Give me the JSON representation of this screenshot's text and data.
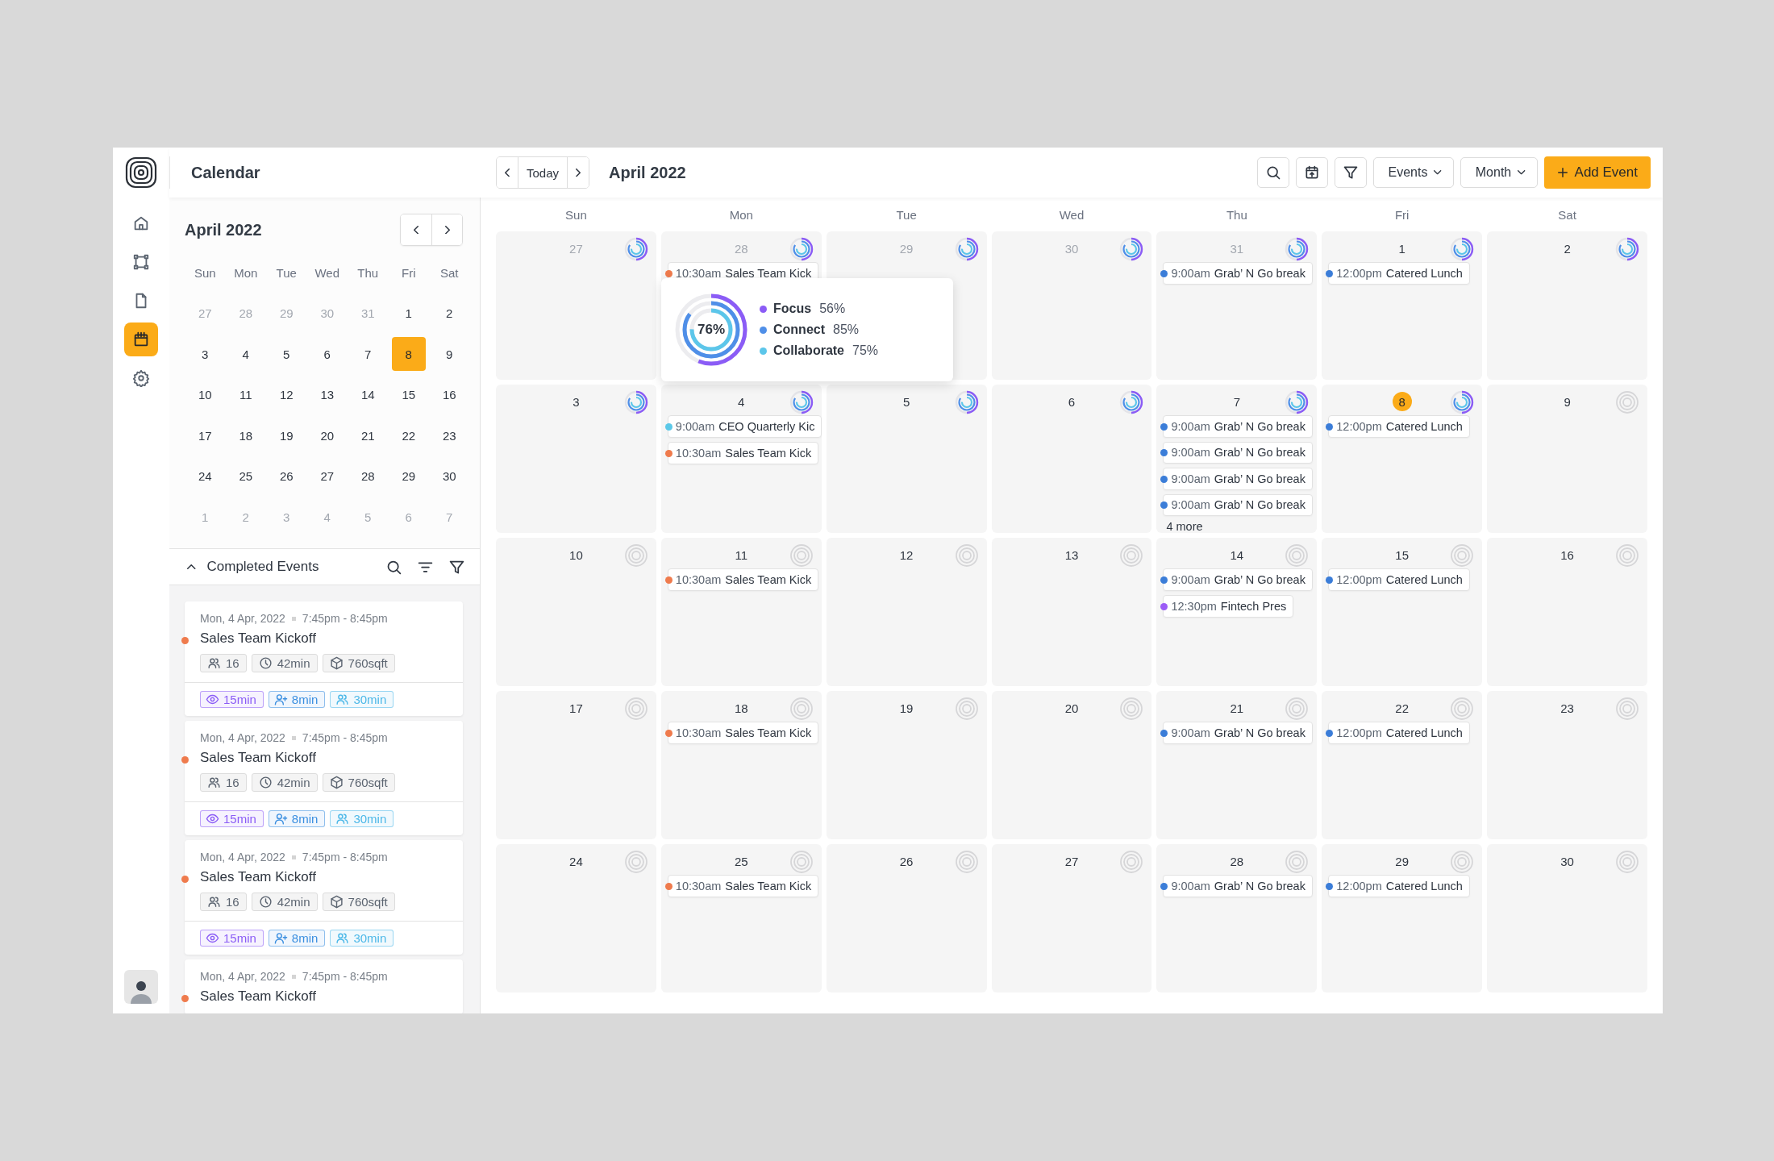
{
  "app": {
    "title": "Calendar"
  },
  "rail": {
    "items": [
      {
        "selected": false
      },
      {
        "selected": false
      },
      {
        "selected": false
      },
      {
        "selected": true
      },
      {
        "selected": false
      }
    ]
  },
  "mini_calendar": {
    "title": "April 2022",
    "weekdays": [
      "Sun",
      "Mon",
      "Tue",
      "Wed",
      "Thu",
      "Fri",
      "Sat"
    ],
    "weeks": [
      [
        {
          "day": "27",
          "muted": true,
          "selected": false
        },
        {
          "day": "28",
          "muted": true,
          "selected": false
        },
        {
          "day": "29",
          "muted": true,
          "selected": false
        },
        {
          "day": "30",
          "muted": true,
          "selected": false
        },
        {
          "day": "31",
          "muted": true,
          "selected": false
        },
        {
          "day": "1",
          "muted": false,
          "selected": false
        },
        {
          "day": "2",
          "muted": false,
          "selected": false
        }
      ],
      [
        {
          "day": "3",
          "muted": false,
          "selected": false
        },
        {
          "day": "4",
          "muted": false,
          "selected": false
        },
        {
          "day": "5",
          "muted": false,
          "selected": false
        },
        {
          "day": "6",
          "muted": false,
          "selected": false
        },
        {
          "day": "7",
          "muted": false,
          "selected": false
        },
        {
          "day": "8",
          "muted": false,
          "selected": true
        },
        {
          "day": "9",
          "muted": false,
          "selected": false
        }
      ],
      [
        {
          "day": "10",
          "muted": false,
          "selected": false
        },
        {
          "day": "11",
          "muted": false,
          "selected": false
        },
        {
          "day": "12",
          "muted": false,
          "selected": false
        },
        {
          "day": "13",
          "muted": false,
          "selected": false
        },
        {
          "day": "14",
          "muted": false,
          "selected": false
        },
        {
          "day": "15",
          "muted": false,
          "selected": false
        },
        {
          "day": "16",
          "muted": false,
          "selected": false
        }
      ],
      [
        {
          "day": "17",
          "muted": false,
          "selected": false
        },
        {
          "day": "18",
          "muted": false,
          "selected": false
        },
        {
          "day": "19",
          "muted": false,
          "selected": false
        },
        {
          "day": "20",
          "muted": false,
          "selected": false
        },
        {
          "day": "21",
          "muted": false,
          "selected": false
        },
        {
          "day": "22",
          "muted": false,
          "selected": false
        },
        {
          "day": "23",
          "muted": false,
          "selected": false
        }
      ],
      [
        {
          "day": "24",
          "muted": false,
          "selected": false
        },
        {
          "day": "25",
          "muted": false,
          "selected": false
        },
        {
          "day": "26",
          "muted": false,
          "selected": false
        },
        {
          "day": "27",
          "muted": false,
          "selected": false
        },
        {
          "day": "28",
          "muted": false,
          "selected": false
        },
        {
          "day": "29",
          "muted": false,
          "selected": false
        },
        {
          "day": "30",
          "muted": false,
          "selected": false
        }
      ],
      [
        {
          "day": "1",
          "muted": true,
          "selected": false
        },
        {
          "day": "2",
          "muted": true,
          "selected": false
        },
        {
          "day": "3",
          "muted": true,
          "selected": false
        },
        {
          "day": "4",
          "muted": true,
          "selected": false
        },
        {
          "day": "5",
          "muted": true,
          "selected": false
        },
        {
          "day": "6",
          "muted": true,
          "selected": false
        },
        {
          "day": "7",
          "muted": true,
          "selected": false
        }
      ]
    ]
  },
  "completed_events": {
    "title": "Completed Events",
    "expanded": true,
    "cards": [
      {
        "date": "Mon, 4 Apr, 2022",
        "time": "7:45pm - 8:45pm",
        "title": "Sales Team Kickoff",
        "color": "#ef7b4d",
        "stats": [
          "16",
          "42min",
          "760sqft"
        ],
        "tags": [
          {
            "text": "15min",
            "color": "#8b5cf6"
          },
          {
            "text": "8min",
            "color": "#3b8fe0"
          },
          {
            "text": "30min",
            "color": "#4cb8e8"
          }
        ]
      },
      {
        "date": "Mon, 4 Apr, 2022",
        "time": "7:45pm - 8:45pm",
        "title": "Sales Team Kickoff",
        "color": "#ef7b4d",
        "stats": [
          "16",
          "42min",
          "760sqft"
        ],
        "tags": [
          {
            "text": "15min",
            "color": "#8b5cf6"
          },
          {
            "text": "8min",
            "color": "#3b8fe0"
          },
          {
            "text": "30min",
            "color": "#4cb8e8"
          }
        ]
      },
      {
        "date": "Mon, 4 Apr, 2022",
        "time": "7:45pm - 8:45pm",
        "title": "Sales Team Kickoff",
        "color": "#ef7b4d",
        "stats": [
          "16",
          "42min",
          "760sqft"
        ],
        "tags": [
          {
            "text": "15min",
            "color": "#8b5cf6"
          },
          {
            "text": "8min",
            "color": "#3b8fe0"
          },
          {
            "text": "30min",
            "color": "#4cb8e8"
          }
        ]
      },
      {
        "date": "Mon, 4 Apr, 2022",
        "time": "7:45pm - 8:45pm",
        "title": "Sales Team Kickoff",
        "color": "#ef7b4d"
      }
    ]
  },
  "toolbar": {
    "today": "Today",
    "title": "April 2022",
    "events_dropdown": "Events",
    "view_dropdown": "Month",
    "add_button": "Add Event"
  },
  "month": {
    "weekdays": [
      "Sun",
      "Mon",
      "Tue",
      "Wed",
      "Thu",
      "Fri",
      "Sat"
    ],
    "weeks": [
      [
        {
          "day": "27",
          "muted": true,
          "today": false,
          "scored": true
        },
        {
          "day": "28",
          "muted": true,
          "today": false,
          "scored": true,
          "events": [
            {
              "time": "10:30am",
              "title": "Sales Team Kick",
              "color": "#ef7b4d"
            }
          ]
        },
        {
          "day": "29",
          "muted": true,
          "today": false,
          "scored": true
        },
        {
          "day": "30",
          "muted": true,
          "today": false,
          "scored": true
        },
        {
          "day": "31",
          "muted": true,
          "today": false,
          "scored": true,
          "events": [
            {
              "time": "9:00am",
              "title": "Grab’ N Go break",
              "color": "#3b7dd8"
            }
          ]
        },
        {
          "day": "1",
          "muted": false,
          "today": false,
          "scored": true,
          "events": [
            {
              "time": "12:00pm",
              "title": "Catered Lunch",
              "color": "#3b7dd8"
            }
          ]
        },
        {
          "day": "2",
          "muted": false,
          "today": false,
          "scored": true
        }
      ],
      [
        {
          "day": "3",
          "muted": false,
          "today": false,
          "scored": true
        },
        {
          "day": "4",
          "muted": false,
          "today": false,
          "scored": true,
          "events": [
            {
              "time": "9:00am",
              "title": "CEO Quarterly Kic",
              "color": "#5bc8e8"
            },
            {
              "time": "10:30am",
              "title": "Sales Team Kick",
              "color": "#ef7b4d"
            }
          ]
        },
        {
          "day": "5",
          "muted": false,
          "today": false,
          "scored": true
        },
        {
          "day": "6",
          "muted": false,
          "today": false,
          "scored": true
        },
        {
          "day": "7",
          "muted": false,
          "today": false,
          "scored": true,
          "events": [
            {
              "time": "9:00am",
              "title": "Grab’ N Go break",
              "color": "#3b7dd8"
            },
            {
              "time": "9:00am",
              "title": "Grab’ N Go break",
              "color": "#3b7dd8"
            },
            {
              "time": "9:00am",
              "title": "Grab’ N Go break",
              "color": "#3b7dd8"
            },
            {
              "time": "9:00am",
              "title": "Grab’ N Go break",
              "color": "#3b7dd8"
            }
          ],
          "more": "4 more"
        },
        {
          "day": "8",
          "muted": false,
          "today": true,
          "scored": true,
          "events": [
            {
              "time": "12:00pm",
              "title": "Catered Lunch",
              "color": "#3b7dd8"
            }
          ]
        },
        {
          "day": "9",
          "muted": false,
          "today": false,
          "scored": false
        }
      ],
      [
        {
          "day": "10",
          "muted": false,
          "today": false,
          "scored": false
        },
        {
          "day": "11",
          "muted": false,
          "today": false,
          "scored": false,
          "events": [
            {
              "time": "10:30am",
              "title": "Sales Team Kick",
              "color": "#ef7b4d"
            }
          ]
        },
        {
          "day": "12",
          "muted": false,
          "today": false,
          "scored": false
        },
        {
          "day": "13",
          "muted": false,
          "today": false,
          "scored": false
        },
        {
          "day": "14",
          "muted": false,
          "today": false,
          "scored": false,
          "events": [
            {
              "time": "9:00am",
              "title": "Grab’ N Go break",
              "color": "#3b7dd8"
            },
            {
              "time": "12:30pm",
              "title": "Fintech Pres",
              "color": "#9b5cf6"
            }
          ]
        },
        {
          "day": "15",
          "muted": false,
          "today": false,
          "scored": false,
          "events": [
            {
              "time": "12:00pm",
              "title": "Catered Lunch",
              "color": "#3b7dd8"
            }
          ]
        },
        {
          "day": "16",
          "muted": false,
          "today": false,
          "scored": false
        }
      ],
      [
        {
          "day": "17",
          "muted": false,
          "today": false,
          "scored": false
        },
        {
          "day": "18",
          "muted": false,
          "today": false,
          "scored": false,
          "events": [
            {
              "time": "10:30am",
              "title": "Sales Team Kick",
              "color": "#ef7b4d"
            }
          ]
        },
        {
          "day": "19",
          "muted": false,
          "today": false,
          "scored": false
        },
        {
          "day": "20",
          "muted": false,
          "today": false,
          "scored": false
        },
        {
          "day": "21",
          "muted": false,
          "today": false,
          "scored": false,
          "events": [
            {
              "time": "9:00am",
              "title": "Grab’ N Go break",
              "color": "#3b7dd8"
            }
          ]
        },
        {
          "day": "22",
          "muted": false,
          "today": false,
          "scored": false,
          "events": [
            {
              "time": "12:00pm",
              "title": "Catered Lunch",
              "color": "#3b7dd8"
            }
          ]
        },
        {
          "day": "23",
          "muted": false,
          "today": false,
          "scored": false
        }
      ],
      [
        {
          "day": "24",
          "muted": false,
          "today": false,
          "scored": false
        },
        {
          "day": "25",
          "muted": false,
          "today": false,
          "scored": false,
          "events": [
            {
              "time": "10:30am",
              "title": "Sales Team Kick",
              "color": "#ef7b4d"
            }
          ]
        },
        {
          "day": "26",
          "muted": false,
          "today": false,
          "scored": false
        },
        {
          "day": "27",
          "muted": false,
          "today": false,
          "scored": false
        },
        {
          "day": "28",
          "muted": false,
          "today": false,
          "scored": false,
          "events": [
            {
              "time": "9:00am",
              "title": "Grab’ N Go break",
              "color": "#3b7dd8"
            }
          ]
        },
        {
          "day": "29",
          "muted": false,
          "today": false,
          "scored": false,
          "events": [
            {
              "time": "12:00pm",
              "title": "Catered Lunch",
              "color": "#3b7dd8"
            }
          ]
        },
        {
          "day": "30",
          "muted": false,
          "today": false,
          "scored": false
        }
      ]
    ]
  },
  "tooltip": {
    "total": "76%",
    "items": [
      {
        "label": "Focus",
        "value": "56%",
        "color": "#8b5cf6",
        "level": 0.56
      },
      {
        "label": "Connect",
        "value": "85%",
        "color": "#4f8fe8",
        "level": 0.85
      },
      {
        "label": "Collaborate",
        "value": "75%",
        "color": "#5cc6ea",
        "level": 0.75
      }
    ]
  }
}
